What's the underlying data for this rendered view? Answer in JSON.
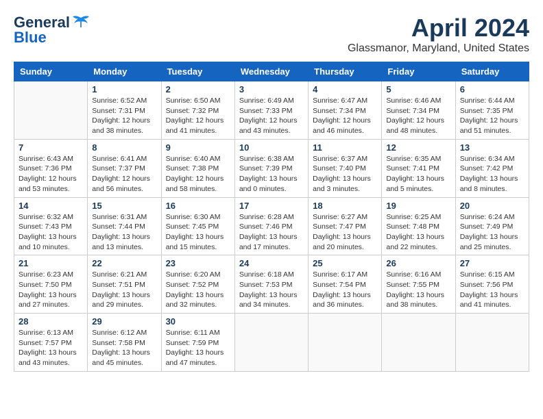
{
  "header": {
    "logo": {
      "line1": "General",
      "line2": "Blue"
    },
    "title": "April 2024",
    "location": "Glassmanor, Maryland, United States"
  },
  "days_of_week": [
    "Sunday",
    "Monday",
    "Tuesday",
    "Wednesday",
    "Thursday",
    "Friday",
    "Saturday"
  ],
  "weeks": [
    [
      {
        "day": "",
        "info": ""
      },
      {
        "day": "1",
        "info": "Sunrise: 6:52 AM\nSunset: 7:31 PM\nDaylight: 12 hours\nand 38 minutes."
      },
      {
        "day": "2",
        "info": "Sunrise: 6:50 AM\nSunset: 7:32 PM\nDaylight: 12 hours\nand 41 minutes."
      },
      {
        "day": "3",
        "info": "Sunrise: 6:49 AM\nSunset: 7:33 PM\nDaylight: 12 hours\nand 43 minutes."
      },
      {
        "day": "4",
        "info": "Sunrise: 6:47 AM\nSunset: 7:34 PM\nDaylight: 12 hours\nand 46 minutes."
      },
      {
        "day": "5",
        "info": "Sunrise: 6:46 AM\nSunset: 7:34 PM\nDaylight: 12 hours\nand 48 minutes."
      },
      {
        "day": "6",
        "info": "Sunrise: 6:44 AM\nSunset: 7:35 PM\nDaylight: 12 hours\nand 51 minutes."
      }
    ],
    [
      {
        "day": "7",
        "info": "Sunrise: 6:43 AM\nSunset: 7:36 PM\nDaylight: 12 hours\nand 53 minutes."
      },
      {
        "day": "8",
        "info": "Sunrise: 6:41 AM\nSunset: 7:37 PM\nDaylight: 12 hours\nand 56 minutes."
      },
      {
        "day": "9",
        "info": "Sunrise: 6:40 AM\nSunset: 7:38 PM\nDaylight: 12 hours\nand 58 minutes."
      },
      {
        "day": "10",
        "info": "Sunrise: 6:38 AM\nSunset: 7:39 PM\nDaylight: 13 hours\nand 0 minutes."
      },
      {
        "day": "11",
        "info": "Sunrise: 6:37 AM\nSunset: 7:40 PM\nDaylight: 13 hours\nand 3 minutes."
      },
      {
        "day": "12",
        "info": "Sunrise: 6:35 AM\nSunset: 7:41 PM\nDaylight: 13 hours\nand 5 minutes."
      },
      {
        "day": "13",
        "info": "Sunrise: 6:34 AM\nSunset: 7:42 PM\nDaylight: 13 hours\nand 8 minutes."
      }
    ],
    [
      {
        "day": "14",
        "info": "Sunrise: 6:32 AM\nSunset: 7:43 PM\nDaylight: 13 hours\nand 10 minutes."
      },
      {
        "day": "15",
        "info": "Sunrise: 6:31 AM\nSunset: 7:44 PM\nDaylight: 13 hours\nand 13 minutes."
      },
      {
        "day": "16",
        "info": "Sunrise: 6:30 AM\nSunset: 7:45 PM\nDaylight: 13 hours\nand 15 minutes."
      },
      {
        "day": "17",
        "info": "Sunrise: 6:28 AM\nSunset: 7:46 PM\nDaylight: 13 hours\nand 17 minutes."
      },
      {
        "day": "18",
        "info": "Sunrise: 6:27 AM\nSunset: 7:47 PM\nDaylight: 13 hours\nand 20 minutes."
      },
      {
        "day": "19",
        "info": "Sunrise: 6:25 AM\nSunset: 7:48 PM\nDaylight: 13 hours\nand 22 minutes."
      },
      {
        "day": "20",
        "info": "Sunrise: 6:24 AM\nSunset: 7:49 PM\nDaylight: 13 hours\nand 25 minutes."
      }
    ],
    [
      {
        "day": "21",
        "info": "Sunrise: 6:23 AM\nSunset: 7:50 PM\nDaylight: 13 hours\nand 27 minutes."
      },
      {
        "day": "22",
        "info": "Sunrise: 6:21 AM\nSunset: 7:51 PM\nDaylight: 13 hours\nand 29 minutes."
      },
      {
        "day": "23",
        "info": "Sunrise: 6:20 AM\nSunset: 7:52 PM\nDaylight: 13 hours\nand 32 minutes."
      },
      {
        "day": "24",
        "info": "Sunrise: 6:18 AM\nSunset: 7:53 PM\nDaylight: 13 hours\nand 34 minutes."
      },
      {
        "day": "25",
        "info": "Sunrise: 6:17 AM\nSunset: 7:54 PM\nDaylight: 13 hours\nand 36 minutes."
      },
      {
        "day": "26",
        "info": "Sunrise: 6:16 AM\nSunset: 7:55 PM\nDaylight: 13 hours\nand 38 minutes."
      },
      {
        "day": "27",
        "info": "Sunrise: 6:15 AM\nSunset: 7:56 PM\nDaylight: 13 hours\nand 41 minutes."
      }
    ],
    [
      {
        "day": "28",
        "info": "Sunrise: 6:13 AM\nSunset: 7:57 PM\nDaylight: 13 hours\nand 43 minutes."
      },
      {
        "day": "29",
        "info": "Sunrise: 6:12 AM\nSunset: 7:58 PM\nDaylight: 13 hours\nand 45 minutes."
      },
      {
        "day": "30",
        "info": "Sunrise: 6:11 AM\nSunset: 7:59 PM\nDaylight: 13 hours\nand 47 minutes."
      },
      {
        "day": "",
        "info": ""
      },
      {
        "day": "",
        "info": ""
      },
      {
        "day": "",
        "info": ""
      },
      {
        "day": "",
        "info": ""
      }
    ]
  ]
}
